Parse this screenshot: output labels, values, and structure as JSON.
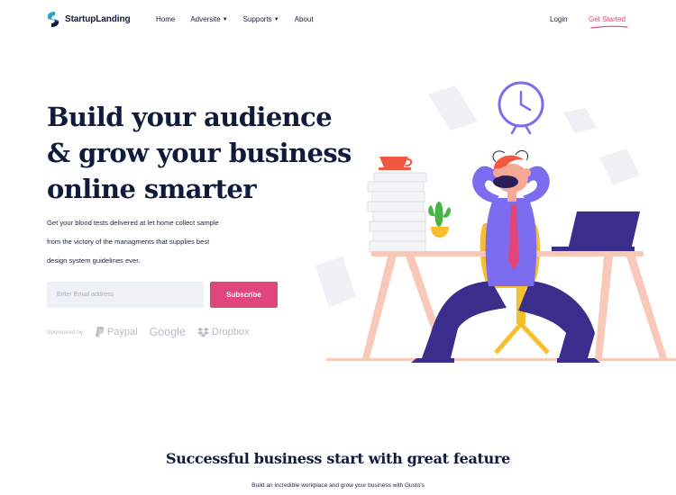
{
  "brand": {
    "name": "StartupLanding"
  },
  "nav": {
    "links": [
      {
        "label": "Home",
        "has_dropdown": false
      },
      {
        "label": "Adversite",
        "has_dropdown": true
      },
      {
        "label": "Supports",
        "has_dropdown": true
      },
      {
        "label": "About",
        "has_dropdown": false
      }
    ],
    "login_label": "Login",
    "cta_label": "Get Started"
  },
  "hero": {
    "title_lines": [
      "Build your audience",
      "& grow your business",
      "online smarter"
    ],
    "description_lines": [
      "Get your blood tests delivered at let home collect sample",
      "from the victory of the managments that supplies best",
      "design system guidelines ever."
    ],
    "email_placeholder": "Enter Email address",
    "subscribe_label": "Subscribe",
    "sponsored_label": "Sponsored by:",
    "sponsors": [
      "Paypal",
      "Google",
      "Dropbox"
    ]
  },
  "feature": {
    "title": "Successful business start with great feature",
    "subtitle": "Build an incredible workplace and grow your business with Gusto's"
  },
  "colors": {
    "accent": "#e0467c",
    "navy": "#0f1a3c",
    "purple": "#7b6cf0",
    "input_bg": "#eef1f5"
  },
  "icons": {
    "logo": "startup-logo-icon",
    "paypal": "paypal-icon",
    "dropbox": "dropbox-icon",
    "caret": "caret-down-icon"
  }
}
